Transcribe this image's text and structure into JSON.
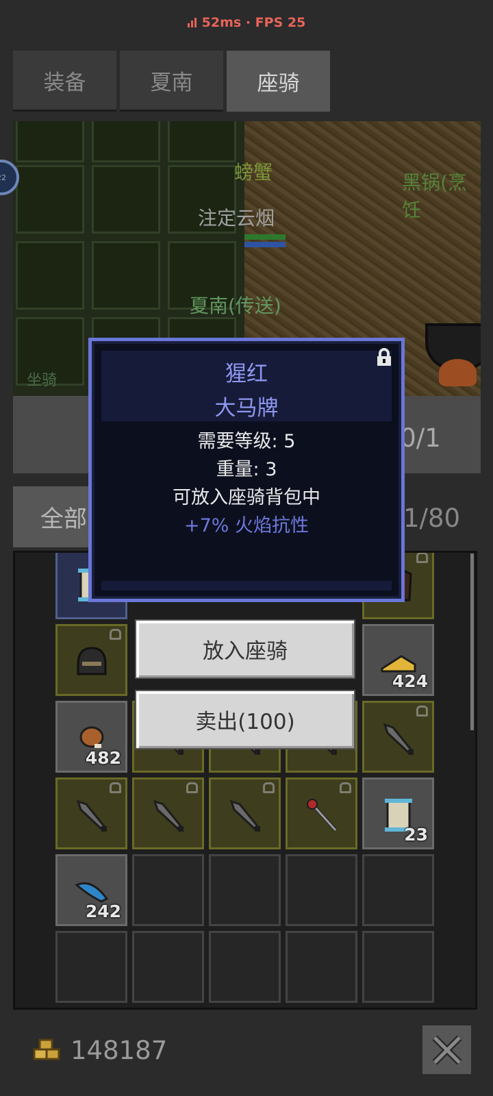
{
  "status": {
    "ping": "52ms",
    "fps": "FPS 25",
    "separator": " · "
  },
  "tabs": [
    {
      "label": "装备",
      "active": false
    },
    {
      "label": "夏南",
      "active": false
    },
    {
      "label": "座骑",
      "active": true
    }
  ],
  "scene": {
    "labels": [
      {
        "text": "螃蟹",
        "color": "#9fbf4a"
      },
      {
        "text": "注定云烟",
        "color": "#cfcfcf"
      },
      {
        "text": "夏南(传送)",
        "color": "#7ec27a"
      },
      {
        "text": "黑锅(烹饪",
        "color": "#6ea84a"
      },
      {
        "text": "坐骑",
        "color": "#5f8a5f"
      }
    ],
    "avatar_badge": "22"
  },
  "mount_slot_count": ": 0/1",
  "filter": {
    "label": "全部"
  },
  "bag_capacity": "1/80",
  "bag": {
    "rows": [
      [
        {
          "style": "blue",
          "icon": "scroll-item-icon",
          "qty": "",
          "locked": false
        },
        {
          "style": "hidden",
          "icon": "",
          "qty": "",
          "locked": false
        },
        {
          "style": "hidden",
          "icon": "",
          "qty": "",
          "locked": false
        },
        {
          "style": "hidden",
          "icon": "",
          "qty": "",
          "locked": false
        },
        {
          "style": "gold",
          "icon": "armor-item-icon",
          "qty": "",
          "locked": true
        }
      ],
      [
        {
          "style": "gold",
          "icon": "helmet-item-icon",
          "qty": "",
          "locked": true
        },
        {
          "style": "hidden",
          "icon": "",
          "qty": "",
          "locked": false
        },
        {
          "style": "hidden",
          "icon": "",
          "qty": "",
          "locked": false
        },
        {
          "style": "hidden",
          "icon": "",
          "qty": "",
          "locked": false
        },
        {
          "style": "gray",
          "icon": "cheese-item-icon",
          "qty": "424",
          "locked": false
        }
      ],
      [
        {
          "style": "gray",
          "icon": "meat-item-icon",
          "qty": "482",
          "locked": false
        },
        {
          "style": "gold",
          "icon": "spear-item-icon",
          "qty": "",
          "locked": false
        },
        {
          "style": "gold",
          "icon": "spear-item-icon",
          "qty": "",
          "locked": false
        },
        {
          "style": "gold",
          "icon": "spear-item-icon",
          "qty": "",
          "locked": false
        },
        {
          "style": "gold",
          "icon": "spear-item-icon",
          "qty": "",
          "locked": true
        }
      ],
      [
        {
          "style": "gold",
          "icon": "spear-item-icon",
          "qty": "",
          "locked": true
        },
        {
          "style": "gold",
          "icon": "spear-item-icon",
          "qty": "",
          "locked": true
        },
        {
          "style": "gold",
          "icon": "spear-item-icon",
          "qty": "",
          "locked": true
        },
        {
          "style": "gold",
          "icon": "staff-item-icon",
          "qty": "",
          "locked": true
        },
        {
          "style": "gray",
          "icon": "scroll-item-icon",
          "qty": "23",
          "locked": false
        }
      ],
      [
        {
          "style": "gray",
          "icon": "feather-item-icon",
          "qty": "242",
          "locked": false
        },
        {
          "style": "empty",
          "icon": "",
          "qty": "",
          "locked": false
        },
        {
          "style": "empty",
          "icon": "",
          "qty": "",
          "locked": false
        },
        {
          "style": "empty",
          "icon": "",
          "qty": "",
          "locked": false
        },
        {
          "style": "empty",
          "icon": "",
          "qty": "",
          "locked": false
        }
      ],
      [
        {
          "style": "empty",
          "icon": "",
          "qty": "",
          "locked": false
        },
        {
          "style": "empty",
          "icon": "",
          "qty": "",
          "locked": false
        },
        {
          "style": "empty",
          "icon": "",
          "qty": "",
          "locked": false
        },
        {
          "style": "empty",
          "icon": "",
          "qty": "",
          "locked": false
        },
        {
          "style": "empty",
          "icon": "",
          "qty": "",
          "locked": false
        }
      ]
    ]
  },
  "popup": {
    "name": "猩红",
    "type": "大马牌",
    "level_req": "需要等级: 5",
    "weight": "重量: 3",
    "note": "可放入座骑背包中",
    "bonus": "+7% 火焰抗性",
    "bonus_color": "#6d78dc"
  },
  "menu": {
    "put_mount": "放入座骑",
    "sell": "卖出(100)"
  },
  "money": "148187",
  "colors": {
    "accent_red": "#e8645a",
    "popup_border": "#6a76d8"
  }
}
